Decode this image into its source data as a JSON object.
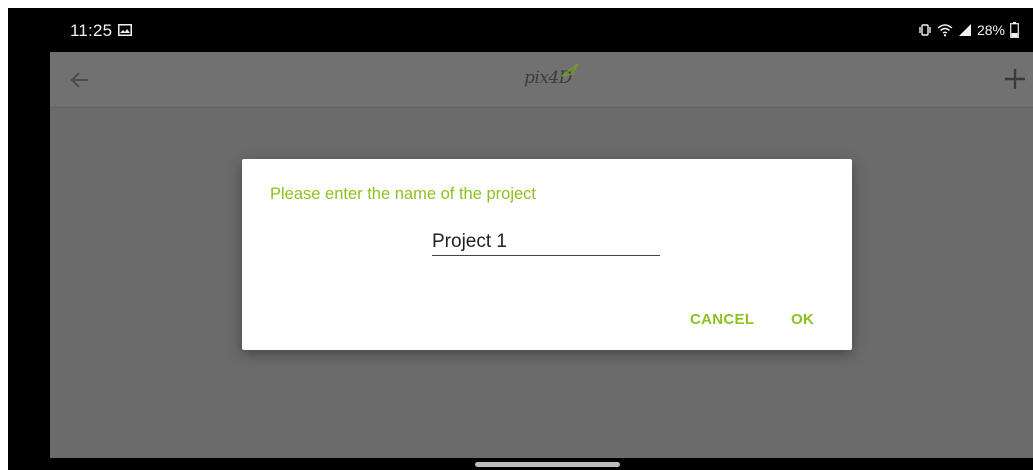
{
  "status_bar": {
    "time": "11:25",
    "battery_text": "28%",
    "icons": [
      "gallery-icon",
      "vibrate-icon",
      "wifi-icon",
      "signal-icon",
      "battery-icon"
    ]
  },
  "app_bar": {
    "logo_text": "pix4D",
    "back_icon": "arrow-left-icon",
    "add_icon": "plus-icon"
  },
  "dialog": {
    "title": "Please enter the name of the project",
    "input_value": "Project 1",
    "cancel_label": "CANCEL",
    "ok_label": "OK"
  },
  "colors": {
    "accent": "#8cc21f",
    "app_background": "#6b6b6b",
    "app_bar": "#717171",
    "status_bar": "#000000"
  }
}
